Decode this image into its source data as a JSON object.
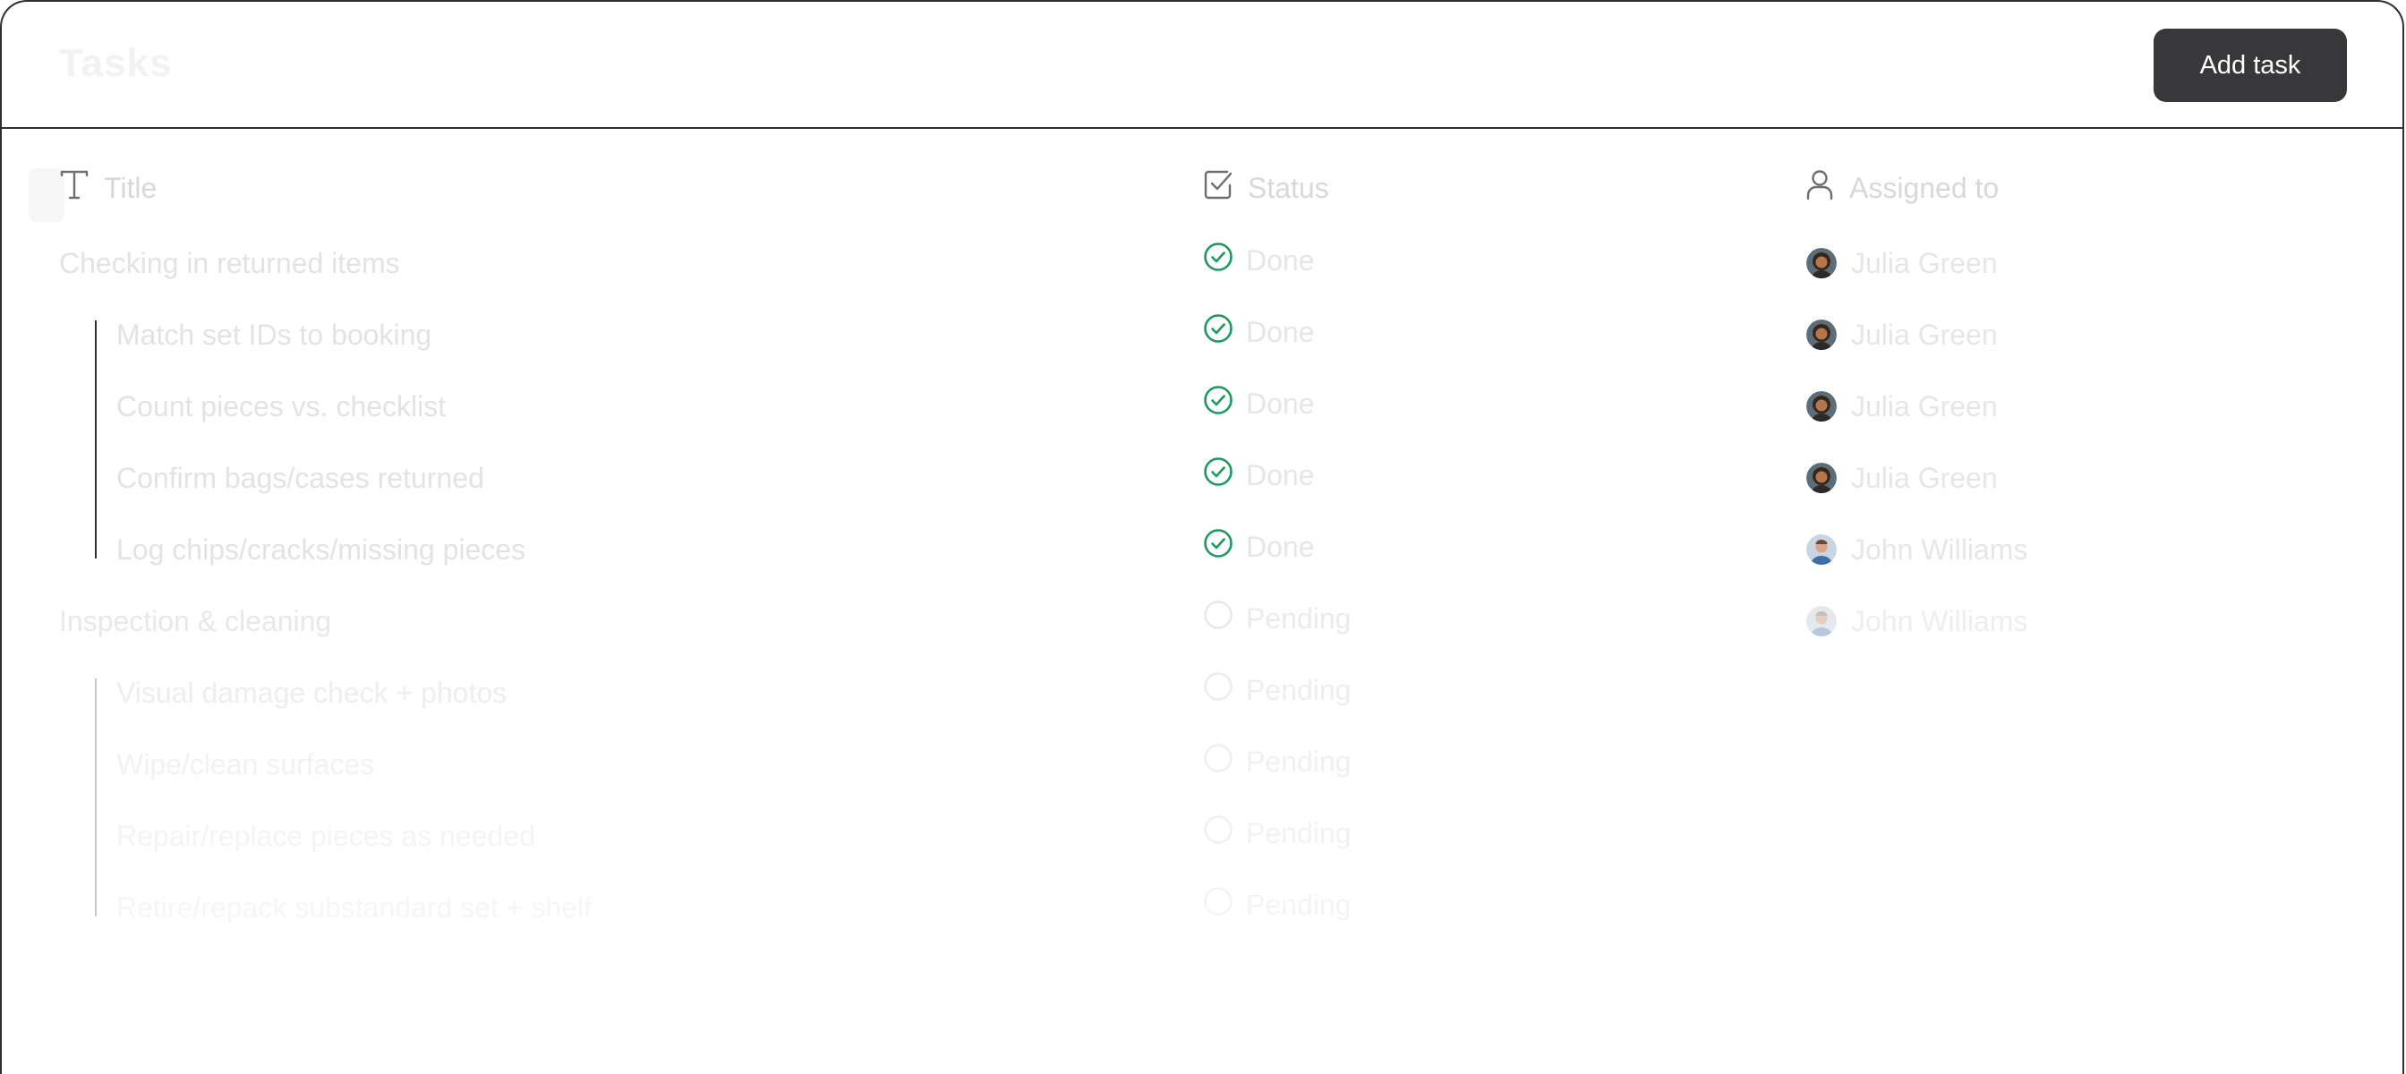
{
  "header": {
    "app_title": "Tasks",
    "add_button_label": "Add task"
  },
  "columns": {
    "title": {
      "label": "Title",
      "icon": "text-t-icon"
    },
    "status": {
      "label": "Status",
      "icon": "checkbox-icon"
    },
    "assigned": {
      "label": "Assigned to",
      "icon": "user-icon"
    }
  },
  "colors": {
    "done_green": "#1a9a5c",
    "button_bg": "#38383a",
    "faded_text": "#d9d9d9"
  },
  "tasks": [
    {
      "title": "Checking in returned items",
      "status": "Done",
      "assignee": "Julia Green",
      "level": 0
    },
    {
      "title": "Match set IDs to booking",
      "status": "Done",
      "assignee": "Julia Green",
      "level": 1
    },
    {
      "title": "Count pieces vs. checklist",
      "status": "Done",
      "assignee": "Julia Green",
      "level": 1
    },
    {
      "title": "Confirm bags/cases returned",
      "status": "Done",
      "assignee": "Julia Green",
      "level": 1
    },
    {
      "title": "Log chips/cracks/missing pieces",
      "status": "Done",
      "assignee": "John Williams",
      "level": 1
    },
    {
      "title": "Inspection & cleaning",
      "status": "Pending",
      "assignee": "John Williams",
      "level": 0
    },
    {
      "title": "Visual damage check + photos",
      "status": "Pending",
      "assignee": "",
      "level": 1
    },
    {
      "title": "Wipe/clean surfaces",
      "status": "Pending",
      "assignee": "",
      "level": 1
    },
    {
      "title": "Repair/replace pieces as needed",
      "status": "Pending",
      "assignee": "",
      "level": 1
    },
    {
      "title": "Retire/repack substandard set + shelf",
      "status": "Pending",
      "assignee": "",
      "level": 1
    }
  ]
}
